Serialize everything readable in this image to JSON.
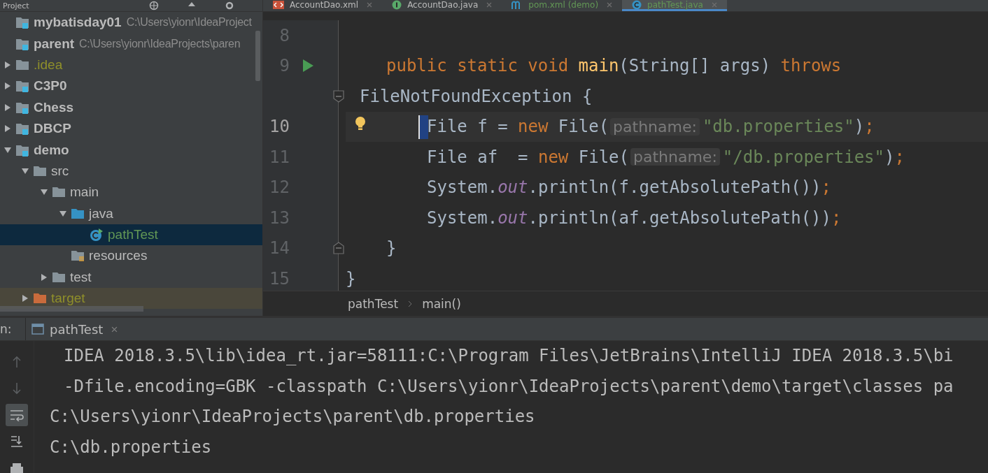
{
  "project_panel": {
    "title": "Project",
    "tree": [
      {
        "label": "mybatisday01",
        "path": "C:\\Users\\yionr\\IdeaProject",
        "kind": "module",
        "selected": false
      },
      {
        "label": "parent",
        "path": "C:\\Users\\yionr\\IdeaProjects\\paren",
        "kind": "module",
        "selected": false,
        "children": [
          {
            "label": ".idea",
            "kind": "folder",
            "ignored": true,
            "expanded": false,
            "selected": false
          },
          {
            "label": "C3P0",
            "kind": "module",
            "expanded": false,
            "selected": false
          },
          {
            "label": "Chess",
            "kind": "module",
            "expanded": false,
            "selected": false
          },
          {
            "label": "DBCP",
            "kind": "module",
            "expanded": false,
            "selected": false
          },
          {
            "label": "demo",
            "kind": "module",
            "expanded": true,
            "selected": false,
            "children": [
              {
                "label": "src",
                "kind": "folder",
                "expanded": true,
                "selected": false,
                "children": [
                  {
                    "label": "main",
                    "kind": "folder",
                    "expanded": true,
                    "selected": false,
                    "children": [
                      {
                        "label": "java",
                        "kind": "source",
                        "expanded": true,
                        "selected": false,
                        "children": [
                          {
                            "label": "pathTest",
                            "kind": "class",
                            "added": true,
                            "selected": true
                          }
                        ]
                      },
                      {
                        "label": "resources",
                        "kind": "resources",
                        "selected": false
                      }
                    ]
                  },
                  {
                    "label": "test",
                    "kind": "folder",
                    "expanded": false,
                    "selected": false
                  }
                ]
              },
              {
                "label": "target",
                "kind": "excluded",
                "ignored": true,
                "expanded": false,
                "selected": false
              }
            ]
          }
        ]
      }
    ]
  },
  "editor": {
    "tabs": [
      {
        "label": "AccountDao.xml",
        "kind": "xml",
        "selected": false
      },
      {
        "label": "AccountDao.java",
        "kind": "interface",
        "selected": false
      },
      {
        "label": "pom.xml (demo)",
        "kind": "maven",
        "added": true,
        "selected": false
      },
      {
        "label": "pathTest.java",
        "kind": "class",
        "added": true,
        "selected": true
      }
    ],
    "lines": [
      {
        "number": "8",
        "kind": "none"
      },
      {
        "number": "9",
        "run": true,
        "kind": "member",
        "tokens": [
          {
            "kind": "keyword",
            "text": "public static void "
          },
          {
            "kind": "decl",
            "text": "main"
          },
          {
            "kind": "plain",
            "text": "(String[] args) "
          },
          {
            "kind": "keyword",
            "text": "throws"
          }
        ]
      },
      {
        "kind": "wrap",
        "fold_start": true,
        "tokens": [
          {
            "kind": "plain",
            "text": "FileNotFoundException {"
          }
        ]
      },
      {
        "number": "10",
        "current": true,
        "bulb": true,
        "kind": "body",
        "tokens": [
          {
            "kind": "plain",
            "text": "File f = "
          },
          {
            "kind": "keyword",
            "text": "new "
          },
          {
            "kind": "plain",
            "text": "File("
          },
          {
            "kind": "hint",
            "text": "pathname:"
          },
          {
            "kind": "string",
            "text": "\"db.properties\""
          },
          {
            "kind": "plain",
            "text": ")"
          },
          {
            "kind": "keyword",
            "text": ";"
          }
        ]
      },
      {
        "number": "11",
        "kind": "body",
        "tokens": [
          {
            "kind": "plain",
            "text": "File af  = "
          },
          {
            "kind": "keyword",
            "text": "new "
          },
          {
            "kind": "plain",
            "text": "File("
          },
          {
            "kind": "hint",
            "text": "pathname:"
          },
          {
            "kind": "string",
            "text": "\"/db.properties\""
          },
          {
            "kind": "plain",
            "text": ")"
          },
          {
            "kind": "keyword",
            "text": ";"
          }
        ]
      },
      {
        "number": "12",
        "kind": "body",
        "tokens": [
          {
            "kind": "plain",
            "text": "System."
          },
          {
            "kind": "field",
            "text": "out"
          },
          {
            "kind": "plain",
            "text": ".println(f.getAbsolutePath())"
          },
          {
            "kind": "keyword",
            "text": ";"
          }
        ]
      },
      {
        "number": "13",
        "kind": "body",
        "tokens": [
          {
            "kind": "plain",
            "text": "System."
          },
          {
            "kind": "field",
            "text": "out"
          },
          {
            "kind": "plain",
            "text": ".println(af.getAbsolutePath())"
          },
          {
            "kind": "keyword",
            "text": ";"
          }
        ]
      },
      {
        "number": "14",
        "kind": "member",
        "fold_end": true,
        "tokens": [
          {
            "kind": "plain",
            "text": "}"
          }
        ]
      },
      {
        "number": "15",
        "kind": "none",
        "tokens": [
          {
            "kind": "plain",
            "text": "}"
          }
        ]
      }
    ],
    "breadcrumbs": [
      "pathTest",
      "main()"
    ]
  },
  "run_panel": {
    "title": "n:",
    "tabs": [
      {
        "label": "pathTest",
        "selected": true
      }
    ],
    "toolbar": [
      {
        "kind": "up",
        "disabled": true,
        "on": false
      },
      {
        "kind": "down",
        "disabled": true,
        "on": false
      },
      {
        "kind": "wrap",
        "disabled": false,
        "on": true
      },
      {
        "kind": "scroll-end",
        "disabled": false,
        "on": false
      },
      {
        "kind": "print",
        "disabled": false,
        "on": false
      }
    ],
    "console": [
      {
        "text": "IDEA 2018.3.5\\lib\\idea_rt.jar=58111:C:\\Program Files\\JetBrains\\IntelliJ IDEA 2018.3.5\\bi",
        "wrapped": true
      },
      {
        "text": "-Dfile.encoding=GBK -classpath C:\\Users\\yionr\\IdeaProjects\\parent\\demo\\target\\classes pa",
        "wrapped": true
      },
      {
        "text": "C:\\Users\\yionr\\IdeaProjects\\parent\\db.properties",
        "wrapped": false
      },
      {
        "text": "C:\\db.properties",
        "wrapped": false
      }
    ]
  }
}
